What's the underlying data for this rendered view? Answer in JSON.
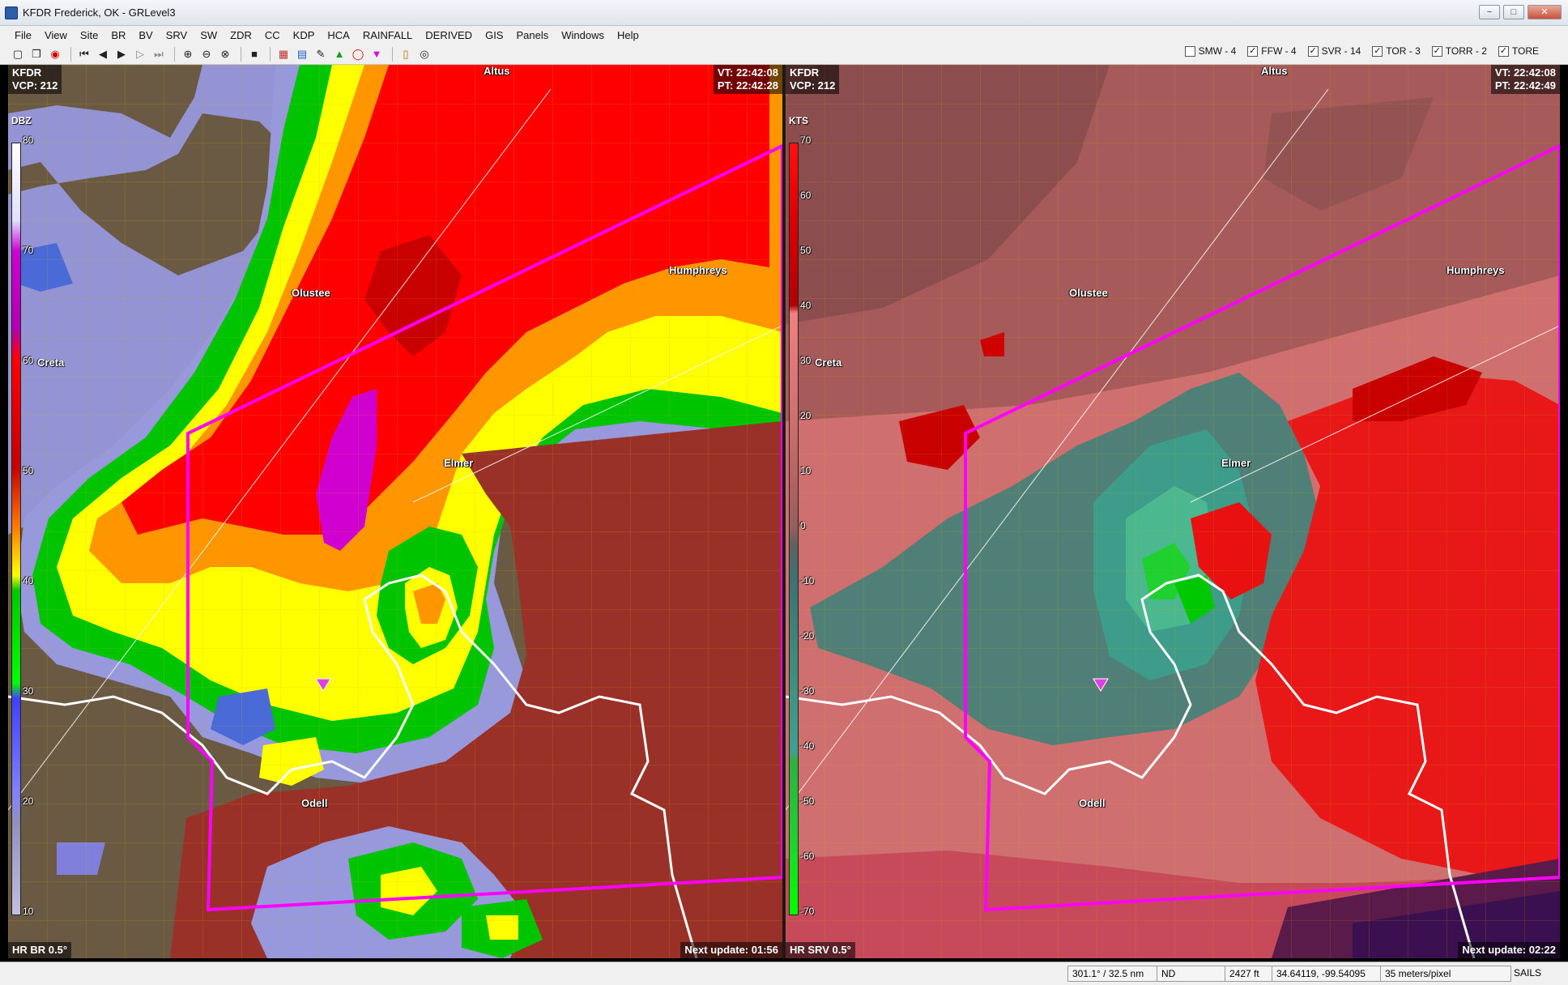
{
  "window": {
    "title": "KFDR Frederick, OK - GRLevel3",
    "controls": [
      "−",
      "□",
      "✕"
    ]
  },
  "menu": [
    "File",
    "View",
    "Site",
    "BR",
    "BV",
    "SRV",
    "SW",
    "ZDR",
    "CC",
    "KDP",
    "HCA",
    "RAINFALL",
    "DERIVED",
    "GIS",
    "Panels",
    "Windows",
    "Help"
  ],
  "toolbar": {
    "icons": [
      "new-icon",
      "copy-icon",
      "record-icon",
      "first-frame-icon",
      "prev-frame-icon",
      "play-icon",
      "next-frame-icon",
      "last-frame-icon",
      "zoom-in-icon",
      "zoom-out-icon",
      "zoom-reset-icon",
      "stop-icon",
      "color-table-icon",
      "layers-icon",
      "pencil-icon",
      "triangle-marker-icon",
      "circle-marker-icon",
      "tvs-marker-icon",
      "bookmark-icon",
      "target-icon"
    ],
    "warnings": [
      {
        "label": "SMW - 4",
        "checked": false
      },
      {
        "label": "FFW - 4",
        "checked": true
      },
      {
        "label": "SVR - 14",
        "checked": true
      },
      {
        "label": "TOR - 3",
        "checked": true
      },
      {
        "label": "TORR - 2",
        "checked": true
      },
      {
        "label": "TORE",
        "checked": true
      }
    ]
  },
  "panels": {
    "left": {
      "site": "KFDR",
      "vcp": "VCP: 212",
      "vt": "VT: 22:42:08",
      "pt": "PT: 22:42:28",
      "unit": "DBZ",
      "product": "HR BR 0.5°",
      "next_update": "Next update: 01:56",
      "scale_ticks": [
        "80",
        "70",
        "60",
        "50",
        "40",
        "30",
        "20",
        "10"
      ],
      "scale_colors": [
        "#ffffff",
        "#e0e0ff",
        "#d000d0",
        "#b000b0",
        "#ff0000",
        "#c80000",
        "#ff8000",
        "#ffff00",
        "#00c800",
        "#00ff00",
        "#4040ff",
        "#8080ff",
        "#9090c0",
        "#c0c0e0"
      ]
    },
    "right": {
      "site": "KFDR",
      "vcp": "VCP: 212",
      "vt": "VT: 22:42:08",
      "pt": "PT: 22:42:49",
      "unit": "KTS",
      "product": "HR SRV 0.5°",
      "next_update": "Next update: 02:22",
      "scale_ticks": [
        "70",
        "60",
        "50",
        "40",
        "30",
        "20",
        "10",
        "0",
        "-10",
        "-20",
        "-30",
        "-40",
        "-50",
        "-60",
        "-70"
      ],
      "scale_colors": [
        "#ff1010",
        "#dd0000",
        "#b00000",
        "#f08080",
        "#d07070",
        "#b06060",
        "#906060",
        "#606060",
        "#407070",
        "#409080",
        "#40a090",
        "#30b040",
        "#20d030",
        "#00ff00"
      ]
    }
  },
  "cities": [
    "Altus",
    "Olustee",
    "Humphreys",
    "Creta",
    "Elmer",
    "Odell"
  ],
  "tvs_marker": "11",
  "status": {
    "azimuth_range": "301.1° / 32.5 nm",
    "value": "ND",
    "height": "2427 ft",
    "coords": "34.64119, -99.54095",
    "resolution": "35 meters/pixel",
    "mode": "SAILS"
  },
  "colors": {
    "ground": "#6b5a43",
    "warning_polygon": "#ff00ff",
    "county_line": "#ffffff",
    "roads": "#c8b400"
  }
}
